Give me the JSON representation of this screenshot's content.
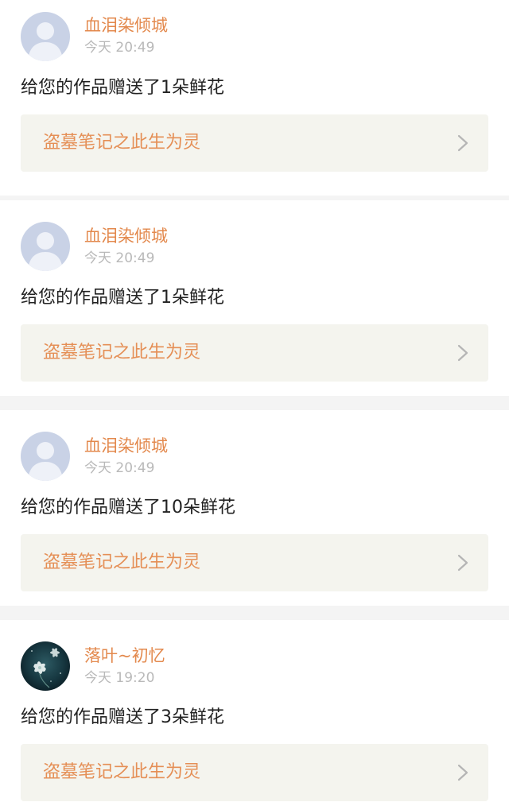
{
  "notifications": [
    {
      "username": "血泪染倾城",
      "time": "今天 20:49",
      "message": "给您的作品赠送了1朵鲜花",
      "work_title": "盗墓笔记之此生为灵",
      "avatar": "default-avatar"
    },
    {
      "username": "血泪染倾城",
      "time": "今天 20:49",
      "message": "给您的作品赠送了1朵鲜花",
      "work_title": "盗墓笔记之此生为灵",
      "avatar": "default-avatar"
    },
    {
      "username": "血泪染倾城",
      "time": "今天 20:49",
      "message": "给您的作品赠送了10朵鲜花",
      "work_title": "盗墓笔记之此生为灵",
      "avatar": "default-avatar"
    },
    {
      "username": "落叶~初忆",
      "time": "今天 19:20",
      "message": "给您的作品赠送了3朵鲜花",
      "work_title": "盗墓笔记之此生为灵",
      "avatar": "flower-avatar"
    }
  ],
  "icons": {
    "chevron": "chevron-right-icon",
    "default_avatar": "default-avatar-icon",
    "flower_avatar": "flower-avatar-image"
  },
  "colors": {
    "username": "#e3894d",
    "work_title": "#e58f56",
    "timestamp": "#b9b9b9",
    "message": "#222222",
    "link_background": "#f4f4ee",
    "page_background": "#f4f4f4"
  }
}
